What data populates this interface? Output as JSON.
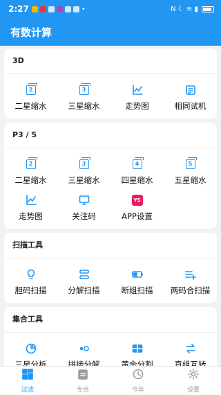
{
  "status_bar": {
    "time": "2:27",
    "right_icons": "N ☾ ≋ ▮"
  },
  "app": {
    "title": "有数计算"
  },
  "colors": {
    "primary": "#2196f3",
    "pink": "#e91e63"
  },
  "sections": [
    {
      "title": "3D",
      "items": [
        {
          "label": "二星缩水",
          "icon": "two-box-icon",
          "digit": "2"
        },
        {
          "label": "三星缩水",
          "icon": "three-box-icon",
          "digit": "3"
        },
        {
          "label": "走势图",
          "icon": "trend-chart-icon"
        },
        {
          "label": "相同试机",
          "icon": "document-icon"
        }
      ]
    },
    {
      "title": "P3 / 5",
      "items": [
        {
          "label": "二星缩水",
          "icon": "two-box-icon",
          "digit": "2"
        },
        {
          "label": "三星缩水",
          "icon": "three-box-icon",
          "digit": "3"
        },
        {
          "label": "四星缩水",
          "icon": "four-box-icon",
          "digit": "4"
        },
        {
          "label": "五星缩水",
          "icon": "five-box-icon",
          "digit": "5"
        },
        {
          "label": "走势图",
          "icon": "trend-chart-icon"
        },
        {
          "label": "关注码",
          "icon": "monitor-icon"
        },
        {
          "label": "APP设置",
          "icon": "ys-logo-icon",
          "badge": "YS"
        }
      ]
    },
    {
      "title": "扫描工具",
      "items": [
        {
          "label": "胆码扫描",
          "icon": "lightbulb-icon"
        },
        {
          "label": "分解扫描",
          "icon": "split-icon"
        },
        {
          "label": "断组扫描",
          "icon": "battery-icon"
        },
        {
          "label": "两码合扫描",
          "icon": "list-add-icon"
        }
      ]
    },
    {
      "title": "集合工具",
      "items": [
        {
          "label": "三星分析",
          "icon": "pie-icon"
        },
        {
          "label": "拼接分解",
          "icon": "dots-icon"
        },
        {
          "label": "黄金分割",
          "icon": "grid-icon"
        },
        {
          "label": "直组互转",
          "icon": "swap-icon"
        }
      ]
    }
  ],
  "bottom_nav": [
    {
      "label": "过滤",
      "icon": "dashboard-icon",
      "active": true
    },
    {
      "label": "专目",
      "icon": "clipboard-icon",
      "active": false
    },
    {
      "label": "今年",
      "icon": "clock-icon",
      "active": false
    },
    {
      "label": "设置",
      "icon": "gear-icon",
      "active": false
    }
  ]
}
